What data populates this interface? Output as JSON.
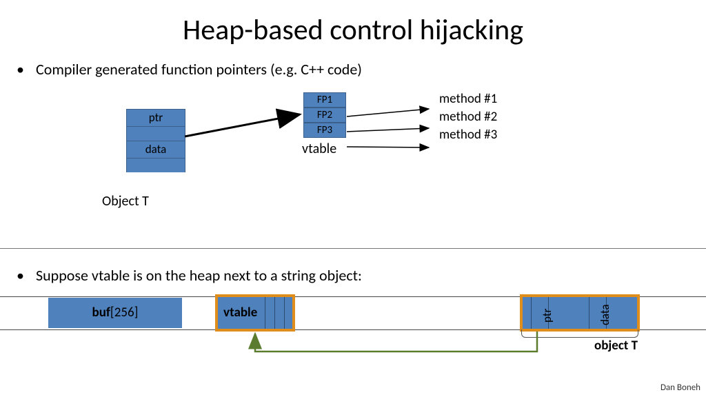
{
  "title": "Heap-based control hijacking",
  "bullet1": "Compiler generated function pointers   (e.g.  C++ code)",
  "bullet2": "Suppose   vtable   is on the heap next to a string object:",
  "object": {
    "ptr": "ptr",
    "data": "data",
    "label": "Object  T"
  },
  "vtable": {
    "fp1": "FP1",
    "fp2": "FP2",
    "fp3": "FP3",
    "label": "vtable"
  },
  "methods": {
    "m1": "method #1",
    "m2": "method #2",
    "m3": "method #3"
  },
  "heap": {
    "buf_bold": "buf",
    "buf_rest": "[256]",
    "vtable": "vtable",
    "obj_ptr": "ptr",
    "obj_data": "data",
    "obj_label": "object T"
  },
  "author": "Dan Boneh"
}
